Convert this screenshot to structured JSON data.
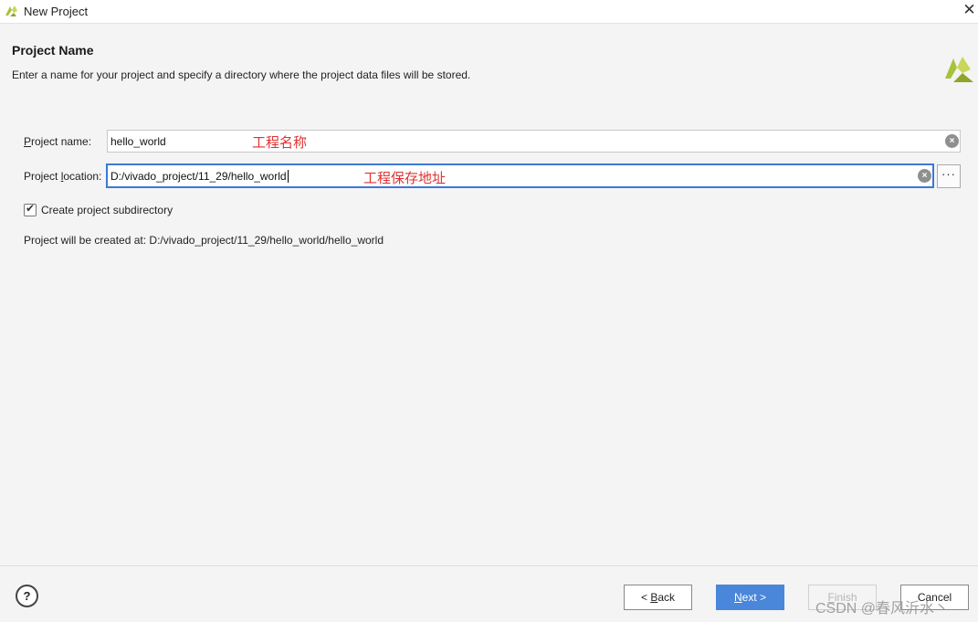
{
  "window": {
    "title": "New Project",
    "close_glyph": "✕"
  },
  "header": {
    "title": "Project Name",
    "description": "Enter a name for your project and specify a directory where the project data files will be stored."
  },
  "form": {
    "project_name": {
      "label_prefix": "",
      "label_mnemonic": "P",
      "label_rest": "roject name:",
      "value": "hello_world",
      "annotation": "工程名称"
    },
    "project_location": {
      "label_prefix": "Project ",
      "label_mnemonic": "l",
      "label_rest": "ocation:",
      "value": "D:/vivado_project/11_29/hello_world",
      "annotation": "工程保存地址",
      "browse_label": "···"
    },
    "create_subdirectory": {
      "label": "Create project subdirectory",
      "checked": true,
      "check_glyph": "✔"
    },
    "result_text": "Project will be created at: D:/vivado_project/11_29/hello_world/hello_world"
  },
  "footer": {
    "help_label": "?",
    "back": {
      "prefix": "< ",
      "mnemonic": "B",
      "rest": "ack"
    },
    "next": {
      "mnemonic": "N",
      "rest": "ext >"
    },
    "finish": {
      "mnemonic": "F",
      "rest": "inish"
    },
    "cancel": {
      "label": "Cancel"
    }
  },
  "watermark": "CSDN @春风沂水丶",
  "colors": {
    "accent": "#4a86d9",
    "focus_border": "#3c78d8",
    "annotation": "#e03131",
    "logo": "#a8c23a"
  },
  "icons": {
    "app": "vivado-logo-icon",
    "clear": "clear-circle-icon",
    "browse": "ellipsis-icon",
    "help": "help-icon"
  }
}
